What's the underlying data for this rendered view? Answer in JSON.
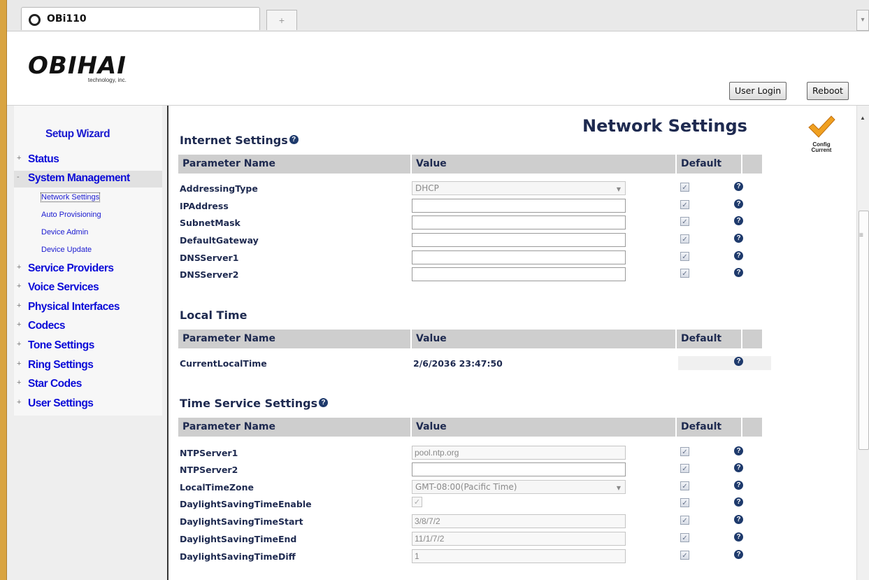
{
  "tab": {
    "title": "OBi110",
    "new_tab": "+"
  },
  "header": {
    "logo": "OBIHAI",
    "logo_sub": "technology, inc.",
    "user_login": "User Login",
    "reboot": "Reboot"
  },
  "sidebar": {
    "setup_wizard": "Setup Wizard",
    "items": [
      {
        "sign": "+",
        "label": "Status"
      },
      {
        "sign": "-",
        "label": "System Management"
      },
      {
        "sign": "+",
        "label": "Service Providers"
      },
      {
        "sign": "+",
        "label": "Voice Services"
      },
      {
        "sign": "+",
        "label": "Physical Interfaces"
      },
      {
        "sign": "+",
        "label": "Codecs"
      },
      {
        "sign": "+",
        "label": "Tone Settings"
      },
      {
        "sign": "+",
        "label": "Ring Settings"
      },
      {
        "sign": "+",
        "label": "Star Codes"
      },
      {
        "sign": "+",
        "label": "User Settings"
      }
    ],
    "subitems": [
      "Network Settings",
      "Auto Provisioning",
      "Device Admin",
      "Device Update"
    ]
  },
  "page": {
    "title": "Network Settings",
    "config_label_1": "Config",
    "config_label_2": "Current",
    "help": "?"
  },
  "columns": {
    "name": "Parameter Name",
    "value": "Value",
    "default": "Default"
  },
  "internet": {
    "title": "Internet Settings",
    "rows": [
      {
        "name": "AddressingType",
        "value": "DHCP"
      },
      {
        "name": "IPAddress",
        "value": ""
      },
      {
        "name": "SubnetMask",
        "value": ""
      },
      {
        "name": "DefaultGateway",
        "value": ""
      },
      {
        "name": "DNSServer1",
        "value": ""
      },
      {
        "name": "DNSServer2",
        "value": ""
      }
    ]
  },
  "localtime": {
    "title": "Local Time",
    "rows": [
      {
        "name": "CurrentLocalTime",
        "value": "2/6/2036 23:47:50"
      }
    ]
  },
  "timeservice": {
    "title": "Time Service Settings",
    "rows": [
      {
        "name": "NTPServer1",
        "value": "pool.ntp.org"
      },
      {
        "name": "NTPServer2",
        "value": ""
      },
      {
        "name": "LocalTimeZone",
        "value": "GMT-08:00(Pacific Time)"
      },
      {
        "name": "DaylightSavingTimeEnable",
        "value": "✓"
      },
      {
        "name": "DaylightSavingTimeStart",
        "value": "3/8/7/2"
      },
      {
        "name": "DaylightSavingTimeEnd",
        "value": "11/1/7/2"
      },
      {
        "name": "DaylightSavingTimeDiff",
        "value": "1"
      }
    ]
  },
  "glyphs": {
    "check": "✓",
    "dropdown_arrow": "▼",
    "scroll_up": "▲",
    "grip": "≡",
    "tab_menu": "▾"
  }
}
